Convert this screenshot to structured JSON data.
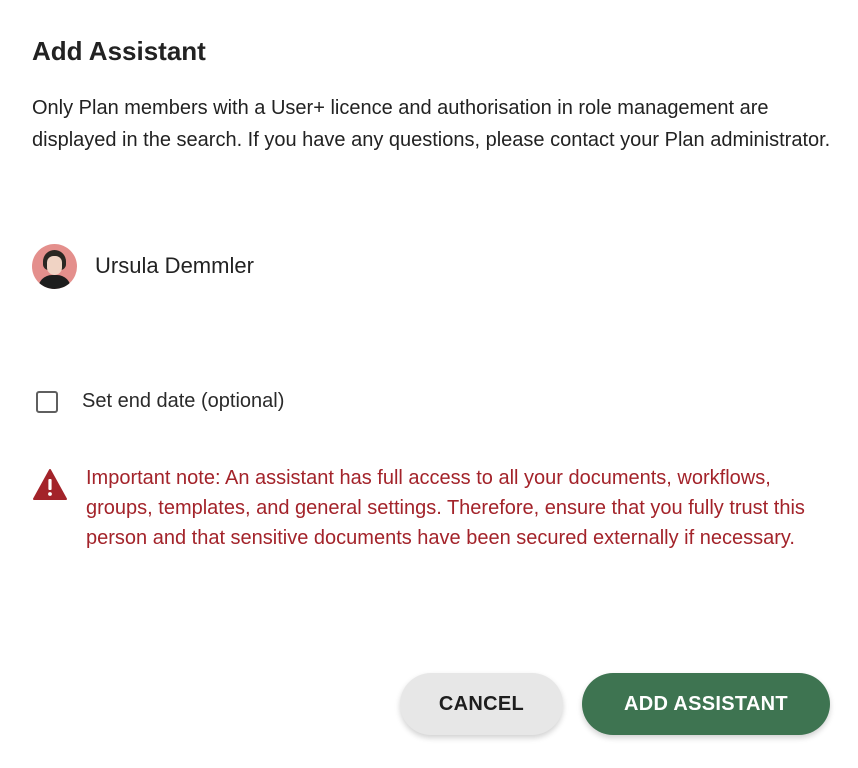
{
  "dialog": {
    "title": "Add Assistant",
    "description": "Only Plan members with a User+ licence and authorisation in role management are displayed in the search. If you have any questions, please contact your Plan administrator."
  },
  "assistant": {
    "name": "Ursula Demmler",
    "avatar_color": "#e48f8c"
  },
  "end_date": {
    "label": "Set end date (optional)",
    "checked": false
  },
  "warning": {
    "icon": "warning-triangle-icon",
    "text": "Important note: An assistant has full access to all your documents, workflows, groups, templates, and general settings. Therefore, ensure that you fully trust this person and that sensitive documents have been secured externally if necessary.",
    "color": "#a3232a"
  },
  "actions": {
    "cancel_label": "CANCEL",
    "add_label": "ADD ASSISTANT",
    "primary_color": "#3e7451"
  }
}
